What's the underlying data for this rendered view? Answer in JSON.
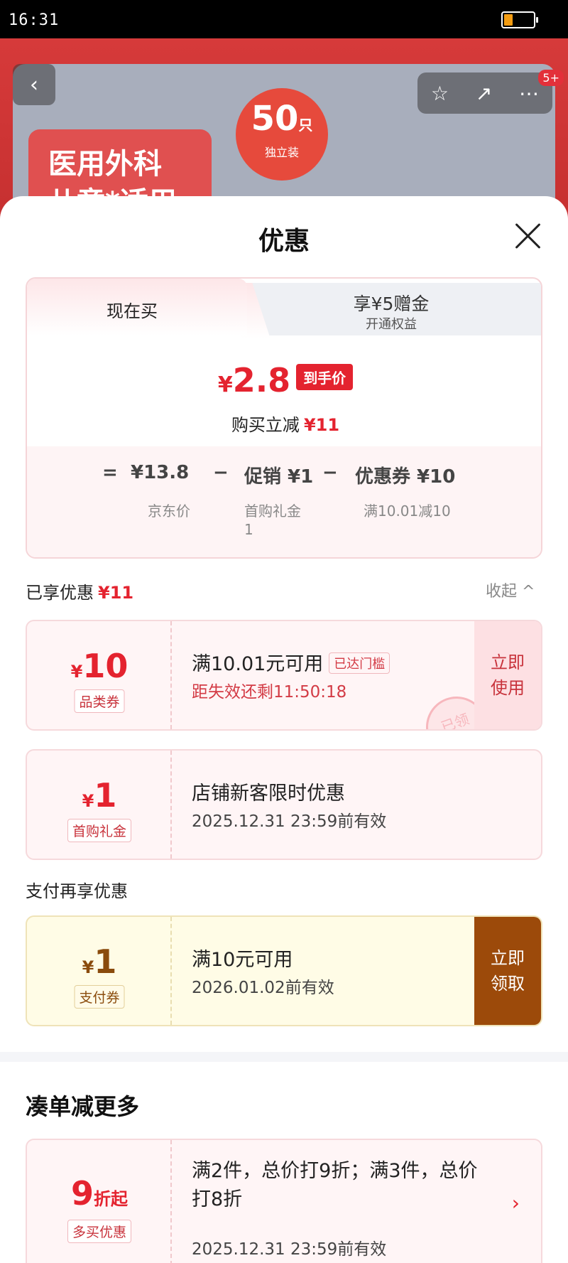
{
  "status": {
    "time": "16:31"
  },
  "background": {
    "badge_line1": "医用外科",
    "badge_line2": "儿童*适用",
    "pack_count": "50",
    "pack_unit": "只",
    "pack_note": "独立装",
    "notif_count": "5+"
  },
  "sheet": {
    "title": "优惠",
    "tabs": [
      {
        "label": "现在买"
      },
      {
        "label": "享¥5赠金",
        "sub": "开通权益"
      }
    ],
    "price": {
      "currency": "¥",
      "value": "2.8",
      "tag": "到手价",
      "reduce_label": "购买立减",
      "reduce_amount": "¥11"
    },
    "breakdown": {
      "eq": "=",
      "jd_price": "¥13.8",
      "jd_label": "京东价",
      "minus1": "−",
      "promo": "促销 ¥1",
      "promo_sub": "首购礼金",
      "promo_sub2": "1",
      "minus2": "−",
      "coupon": "优惠券 ¥10",
      "coupon_sub": "满10.01减10"
    },
    "enjoyed": {
      "label": "已享优惠",
      "amount": "¥11",
      "collapse": "收起 ^"
    },
    "coupons": [
      {
        "currency": "¥",
        "value": "10",
        "label": "品类券",
        "line1": "满10.01元可用",
        "line1_tag": "已达门槛",
        "line2": "距失效还剩11:50:18",
        "action_l1": "立即",
        "action_l2": "使用",
        "stamp": "已领"
      },
      {
        "currency": "¥",
        "value": "1",
        "label": "首购礼金",
        "line1": "店铺新客限时优惠",
        "line2": "2025.12.31 23:59前有效"
      }
    ],
    "pay_section": "支付再享优惠",
    "pay_coupon": {
      "currency": "¥",
      "value": "1",
      "label": "支付券",
      "line1": "满10元可用",
      "line2": "2026.01.02前有效",
      "action_l1": "立即",
      "action_l2": "领取"
    },
    "more_title": "凑单减更多",
    "multi": {
      "value": "9",
      "suffix": "折起",
      "label": "多买优惠",
      "line1": "满2件，总价打9折；满3件，总价打8折",
      "line2": "2025.12.31 23:59前有效"
    }
  }
}
